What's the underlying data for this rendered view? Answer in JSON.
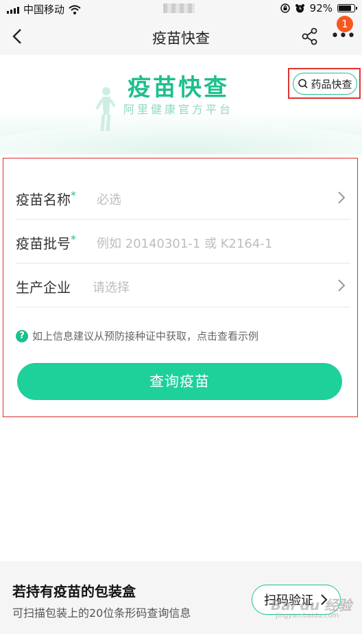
{
  "status_bar": {
    "carrier": "中国移动",
    "battery_percent": "92%",
    "battery_level": 0.92
  },
  "nav": {
    "title": "疫苗快查",
    "badge_count": "1"
  },
  "banner": {
    "title": "疫苗快查",
    "subtitle": "阿里健康官方平台",
    "drug_check_button": "药品快查"
  },
  "form": {
    "fields": [
      {
        "label": "疫苗名称",
        "required_mark": "*",
        "placeholder": "必选"
      },
      {
        "label": "疫苗批号",
        "required_mark": "*",
        "placeholder": "例如 20140301-1 或 K2164-1"
      },
      {
        "label": "生产企业",
        "required_mark": "",
        "placeholder": "请选择"
      }
    ],
    "hint_icon": "?",
    "hint": "如上信息建议从预防接种证中获取，点击查看示例",
    "submit": "查询疫苗"
  },
  "bottom_card": {
    "title": "若持有疫苗的包装盒",
    "subtitle": "可扫描包装上的20位条形码查询信息",
    "scan_button": "扫码验证"
  },
  "watermark": {
    "text": "Bai du 经验",
    "sub": "jingyan.baidu.com"
  },
  "colors": {
    "accent": "#1dbf8e",
    "button": "#1ed09a",
    "highlight_border": "#d62d2d",
    "badge": "#f5581f"
  },
  "icons": [
    "back-arrow-icon",
    "share-icon",
    "more-icon",
    "search-icon",
    "chevron-right-icon",
    "question-icon",
    "wifi-icon",
    "alarm-icon",
    "rotation-lock-icon"
  ]
}
